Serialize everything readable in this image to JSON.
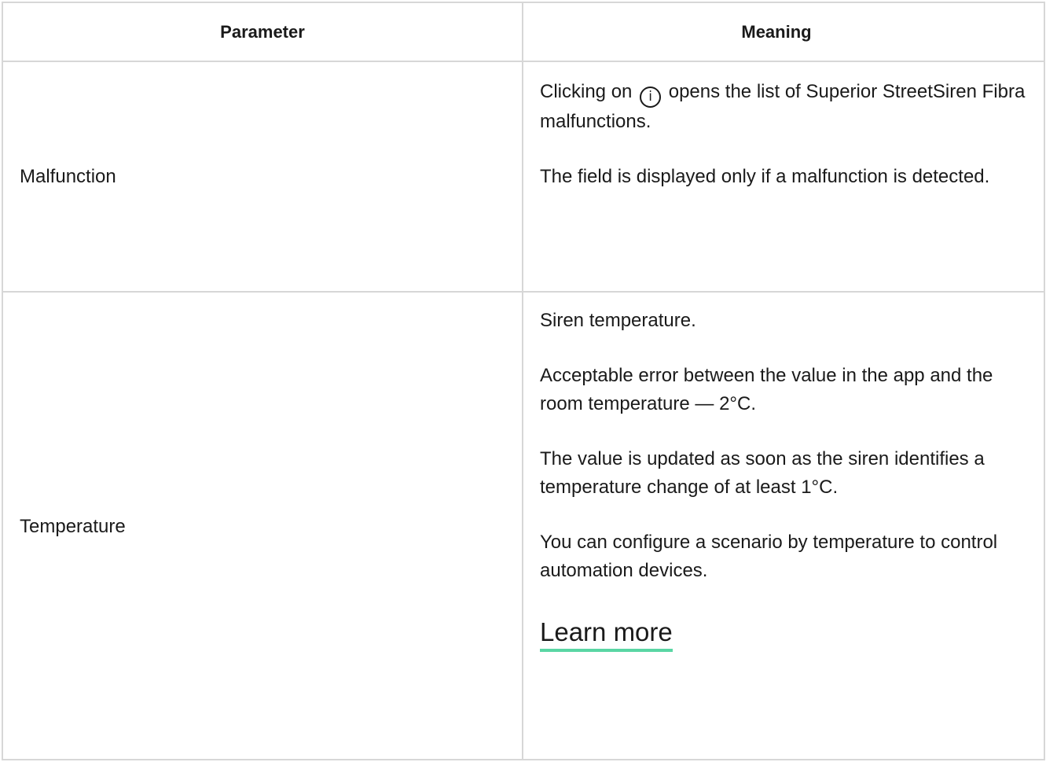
{
  "table": {
    "headers": {
      "parameter": "Parameter",
      "meaning": "Meaning"
    },
    "rows": [
      {
        "parameter": "Malfunction",
        "meaning": {
          "p1_before_icon": "Clicking on ",
          "icon_glyph": "i",
          "icon": "info-circle-icon",
          "p1_after_icon": " opens the list of Superior StreetSiren Fibra malfunctions.",
          "p2": "The field is displayed only if a malfunction is detected."
        }
      },
      {
        "parameter": "Temperature",
        "meaning": {
          "p1": "Siren temperature.",
          "p2": "Acceptable error between the value in the app and the room temperature — 2°C.",
          "p3": "The value is updated as soon as the siren identifies a temperature change of at least 1°C.",
          "p4": "You can configure a scenario by temperature to control automation devices.",
          "link": "Learn more"
        }
      }
    ]
  },
  "colors": {
    "border": "#d7d7d7",
    "text": "#1a1a1a",
    "link_underline": "#5ad6a4"
  }
}
